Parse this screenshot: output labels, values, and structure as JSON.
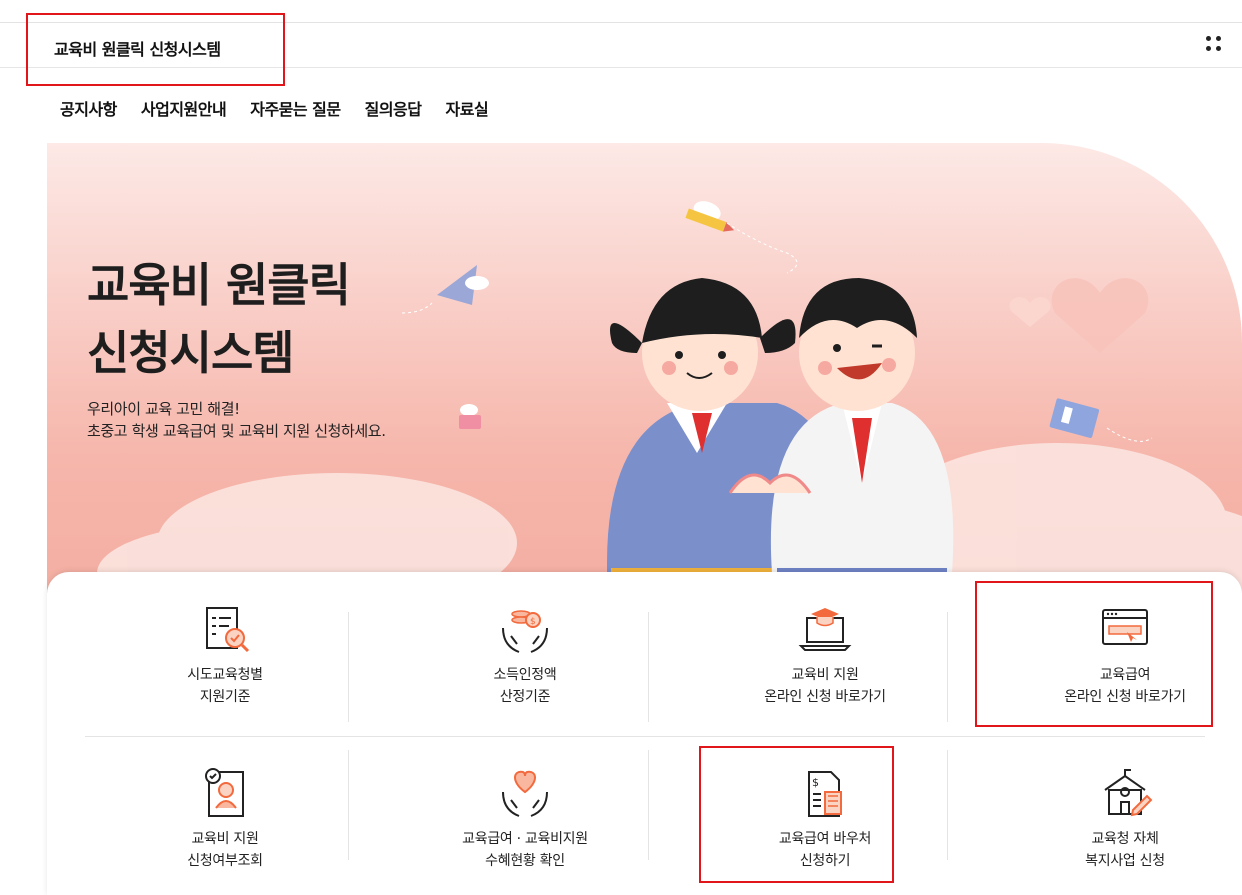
{
  "header": {
    "site_title": "교육비 원클릭 신청시스템",
    "menu_icon": "grid-dots-icon"
  },
  "nav": {
    "items": [
      "공지사항",
      "사업지원안내",
      "자주묻는 질문",
      "질의응답",
      "자료실"
    ]
  },
  "hero": {
    "title_line1": "교육비 원클릭",
    "title_line2": "신청시스템",
    "sub_line1": "우리아이 교육 고민 해결!",
    "sub_line2": "초중고 학생 교육급여 및 교육비 지원 신청하세요."
  },
  "services": [
    {
      "line1": "시도교육청별",
      "line2": "지원기준",
      "icon": "document-search-icon"
    },
    {
      "line1": "소득인정액",
      "line2": "산정기준",
      "icon": "hands-coins-icon"
    },
    {
      "line1": "교육비 지원",
      "line2": "온라인 신청 바로가기",
      "icon": "laptop-graduation-icon"
    },
    {
      "line1": "교육급여",
      "line2": "온라인 신청 바로가기",
      "icon": "browser-click-icon"
    },
    {
      "line1": "교육비 지원",
      "line2": "신청여부조회",
      "icon": "person-check-icon"
    },
    {
      "line1": "교육급여 · 교육비지원",
      "line2": "수혜현황 확인",
      "icon": "hands-heart-icon"
    },
    {
      "line1": "교육급여 바우처",
      "line2": "신청하기",
      "icon": "voucher-calculator-icon"
    },
    {
      "line1": "교육청 자체",
      "line2": "복지사업 신청",
      "icon": "school-pencil-icon"
    }
  ],
  "colors": {
    "accent": "#f26a3d",
    "highlight_border": "#e0161b",
    "hero_pink": "#f6b6ab"
  }
}
